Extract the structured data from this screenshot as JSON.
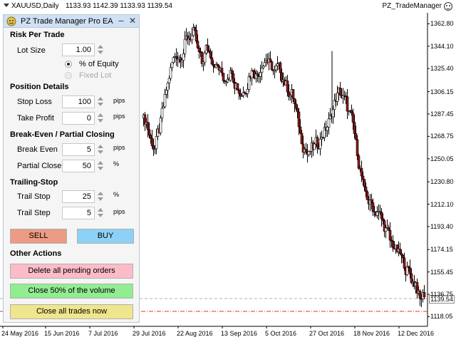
{
  "chart_header": {
    "symbol": "XAUUSD,Daily",
    "ohlc": "1133.93  1142.39  1133.93  1139.54",
    "ea_name": "PZ_TradeManager"
  },
  "panel": {
    "title": "PZ Trade Manager Pro EA",
    "minimize": "–",
    "close": "✕",
    "sections": {
      "risk": "Risk Per Trade",
      "position": "Position Details",
      "breakeven": "Break-Even / Partial Closing",
      "trailing": "Trailing-Stop",
      "other": "Other Actions"
    },
    "lot_size": {
      "label": "Lot Size",
      "value": "1.00"
    },
    "radios": {
      "equity": {
        "label": "% of Equity",
        "selected": true
      },
      "fixed": {
        "label": "Fixed Lot",
        "selected": false
      }
    },
    "stop_loss": {
      "label": "Stop Loss",
      "value": "100",
      "unit": "pips"
    },
    "take_profit": {
      "label": "Take Profit",
      "value": "0",
      "unit": "pips"
    },
    "break_even": {
      "label": "Break Even",
      "value": "5",
      "unit": "pips"
    },
    "partial_close": {
      "label": "Partial Close",
      "value": "50",
      "unit": "%"
    },
    "trail_stop": {
      "label": "Trail Stop",
      "value": "25",
      "unit": "%"
    },
    "trail_step": {
      "label": "Trail Step",
      "value": "5",
      "unit": "pips"
    },
    "buttons": {
      "sell": "SELL",
      "buy": "BUY",
      "delete_pending": "Delete all pending orders",
      "close_half": "Close 50% of the volume",
      "close_all": "Close all trades now"
    }
  },
  "colors": {
    "sell": "#ec9b84",
    "buy": "#8ed1f6",
    "delete": "#fbbcc8",
    "close_half": "#92ec92",
    "close_all": "#efe58c",
    "bull_candle": "#ffffff",
    "bear_candle": "#8b1a1a",
    "red_line": "#e03030"
  },
  "icons": {
    "title": "ea-icon",
    "header_dropdown": "chevron-down-icon",
    "header_status": "smiley-icon"
  },
  "chart_data": {
    "type": "candlestick",
    "ylim": [
      1110,
      1372
    ],
    "y_ticks": [
      "1362.80",
      "1344.10",
      "1325.40",
      "1306.15",
      "1287.45",
      "1268.75",
      "1250.05",
      "1230.80",
      "1212.10",
      "1193.40",
      "1174.15",
      "1155.45",
      "1136.75",
      "1118.05"
    ],
    "x_ticks": [
      "24 May 2016",
      "15 Jun 2016",
      "7 Jul 2016",
      "29 Jul 2016",
      "22 Aug 2016",
      "13 Sep 2016",
      "5 Oct 2016",
      "27 Oct 2016",
      "18 Nov 2016",
      "12 Dec 2016"
    ],
    "current_price": "1139.54",
    "close_path": [
      1280,
      1266,
      1258,
      1275,
      1294,
      1312,
      1330,
      1338,
      1336,
      1345,
      1352,
      1355,
      1340,
      1330,
      1342,
      1338,
      1330,
      1325,
      1318,
      1320,
      1326,
      1312,
      1304,
      1308,
      1318,
      1326,
      1320,
      1330,
      1334,
      1328,
      1322,
      1326,
      1316,
      1310,
      1304,
      1290,
      1270,
      1258,
      1252,
      1260,
      1264,
      1270,
      1276,
      1284,
      1296,
      1306,
      1300,
      1294,
      1284,
      1262,
      1240,
      1222,
      1214,
      1210,
      1206,
      1200,
      1190,
      1182,
      1176,
      1170,
      1164,
      1156,
      1150,
      1146,
      1132,
      1138
    ]
  }
}
